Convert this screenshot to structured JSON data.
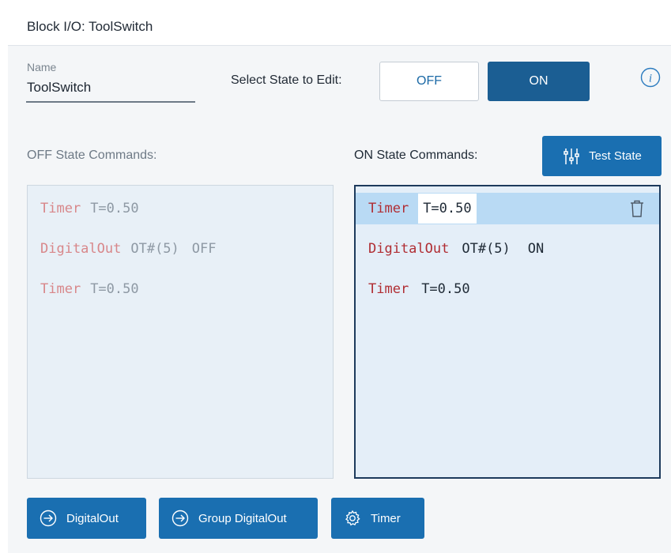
{
  "header": {
    "title": "Block I/O: ToolSwitch"
  },
  "name_field": {
    "label": "Name",
    "value": "ToolSwitch"
  },
  "state_selector": {
    "label": "Select State to Edit:",
    "options": [
      "OFF",
      "ON"
    ],
    "selected": "ON"
  },
  "off_panel": {
    "title": "OFF State Commands:",
    "commands": [
      {
        "keyword": "Timer",
        "args": [
          "T=0.50"
        ]
      },
      {
        "keyword": "DigitalOut",
        "args": [
          "OT#(5)",
          "OFF"
        ]
      },
      {
        "keyword": "Timer",
        "args": [
          "T=0.50"
        ]
      }
    ]
  },
  "on_panel": {
    "title": "ON State Commands:",
    "test_button_label": "Test State",
    "commands": [
      {
        "keyword": "Timer",
        "args": [
          "T=0.50"
        ],
        "selected": true
      },
      {
        "keyword": "DigitalOut",
        "args": [
          "OT#(5)",
          "ON"
        ]
      },
      {
        "keyword": "Timer",
        "args": [
          "T=0.50"
        ]
      }
    ]
  },
  "add_buttons": [
    "DigitalOut",
    "Group DigitalOut",
    "Timer"
  ],
  "icons": {
    "info": "info-icon",
    "test": "sliders-icon",
    "trash": "trash-icon",
    "add": "arrow-circle-icon",
    "timer": "gear-icon"
  },
  "colors": {
    "accent": "#1a6fb1",
    "selected_state": "#1b5e93",
    "keyword": "#b02d33",
    "row_highlight": "#b9daf4"
  }
}
